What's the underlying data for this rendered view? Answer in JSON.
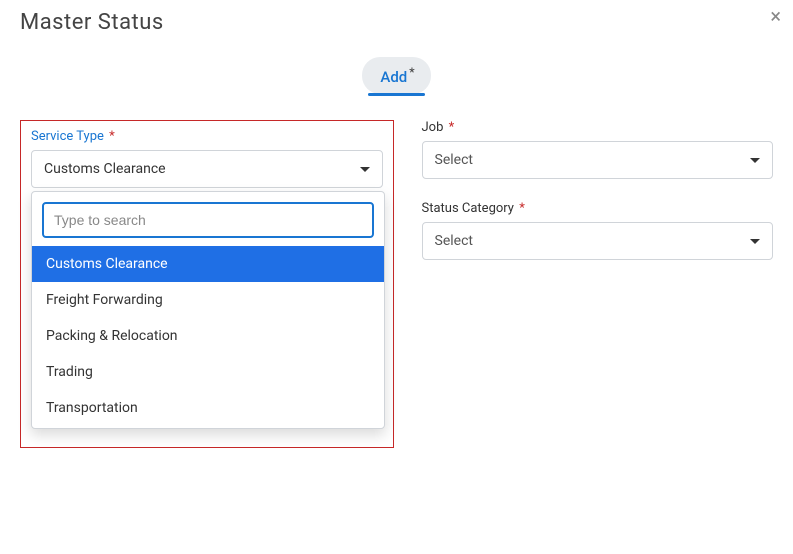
{
  "title": "Master Status",
  "close_glyph": "×",
  "tab": {
    "label": "Add",
    "star": "*"
  },
  "left": {
    "service_type_label": "Service Type",
    "service_type_value": "Customs Clearance",
    "search_placeholder": "Type to search",
    "options": [
      "Customs Clearance",
      "Freight Forwarding",
      "Packing & Relocation",
      "Trading",
      "Transportation"
    ],
    "selected_index": 0
  },
  "right": {
    "job_label": "Job",
    "job_value": "Select",
    "status_category_label": "Status Category",
    "status_category_value": "Select"
  },
  "req": "*"
}
